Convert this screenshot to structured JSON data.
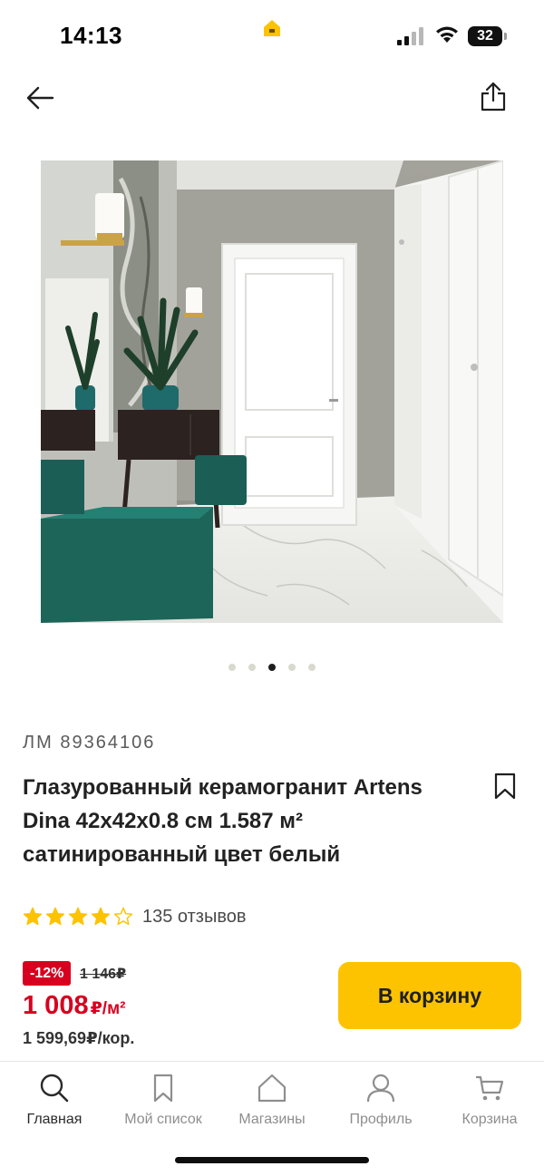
{
  "status_bar": {
    "time": "14:13",
    "battery": "32"
  },
  "nav": {
    "back_icon": "arrow-left-icon",
    "share_icon": "share-icon"
  },
  "gallery": {
    "dot_count": 5,
    "active_dot": 2
  },
  "product": {
    "sku": "ЛМ 89364106",
    "title_lines": [
      "Глазурованный керамогранит Artens",
      "Dina 42x42x0.8 см 1.587 м²",
      "сатинированный цвет белый"
    ],
    "rating": 4,
    "rating_max": 5,
    "reviews": "135 отзывов",
    "discount": "-12%",
    "old_price": "1 146₽",
    "price": "1 008",
    "price_unit": "₽/м²",
    "price_per_box": "1 599,69₽/кор.",
    "cart_label": "В корзину"
  },
  "colors": {
    "accent_yellow": "#fdc300",
    "discount_red": "#d7001f",
    "star_yellow": "#fdc300"
  },
  "tabbar": {
    "tabs": [
      {
        "label": "Главная",
        "icon": "search-icon",
        "active": true
      },
      {
        "label": "Мой список",
        "icon": "bookmark-icon",
        "active": false
      },
      {
        "label": "Магазины",
        "icon": "store-icon",
        "active": false
      },
      {
        "label": "Профиль",
        "icon": "profile-icon",
        "active": false
      },
      {
        "label": "Корзина",
        "icon": "cart-icon",
        "active": false
      }
    ]
  }
}
